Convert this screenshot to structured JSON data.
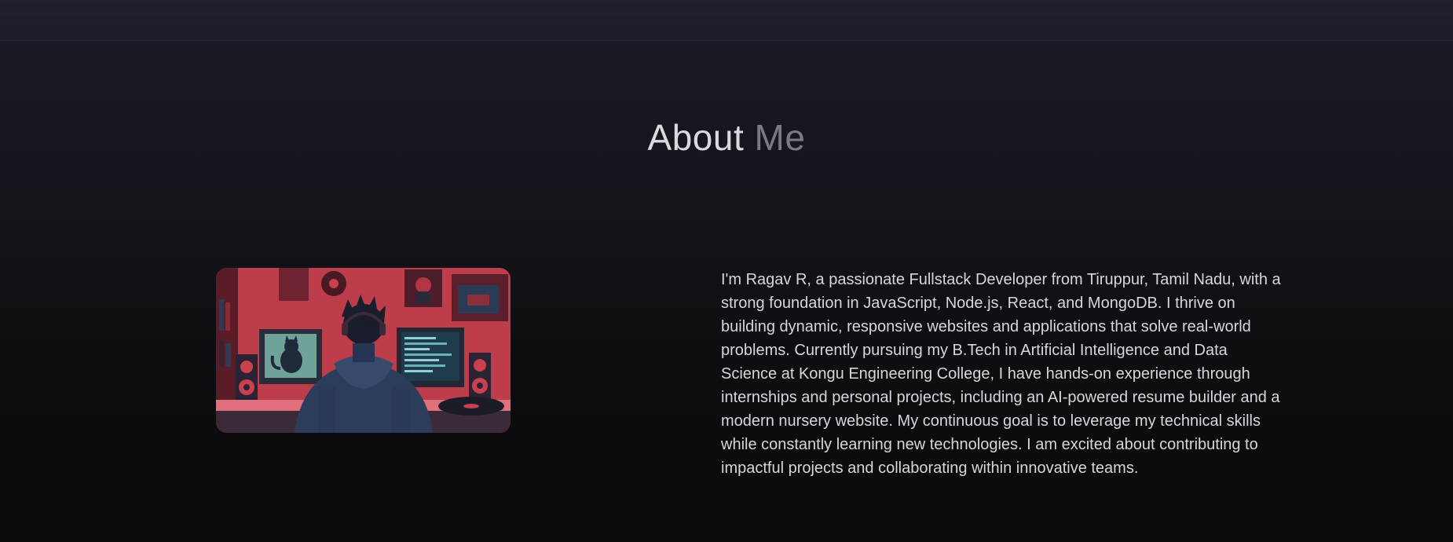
{
  "about": {
    "title_main": "About",
    "title_accent": "Me",
    "bio": "I'm Ragav R, a passionate Fullstack Developer from Tiruppur, Tamil Nadu, with a strong foundation in JavaScript, Node.js, React, and MongoDB. I thrive on building dynamic, responsive websites and applications that solve real-world problems. Currently pursuing my B.Tech in Artificial Intelligence and Data Science at Kongu Engineering College, I have hands-on experience through internships and personal projects, including an AI-powered resume builder and a modern nursery website. My continuous goal is to leverage my technical skills while constantly learning new technologies. I am excited about contributing to impactful projects and collaborating within innovative teams.",
    "image_icon": "developer-illustration"
  },
  "colors": {
    "background": "#0e0e12",
    "title": "#d9d9de",
    "title_accent": "#7a7a80",
    "text": "#d6d6dc",
    "illustration_red": "#c9404f"
  }
}
